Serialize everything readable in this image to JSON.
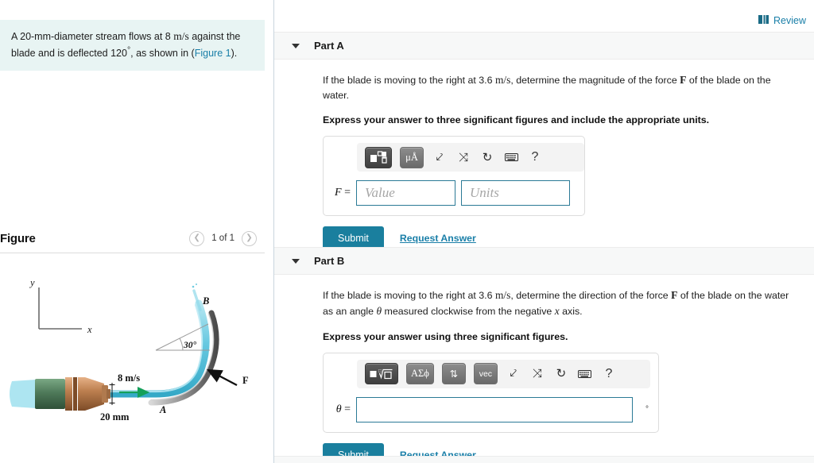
{
  "problem": {
    "text_part1": "A 20-mm-diameter stream flows at 8 ",
    "units_speed": "m/s",
    "text_part2": " against the blade and is deflected 120",
    "degree": "°",
    "text_part3": ", as shown in (",
    "figure_link": "Figure 1",
    "text_part4": ")."
  },
  "figure_panel": {
    "title": "Figure",
    "prev_icon": "chevron-left-icon",
    "next_icon": "chevron-right-icon",
    "counter": "1 of 1",
    "diagram": {
      "axis_y_label": "y",
      "axis_x_label": "x",
      "point_a": "A",
      "point_b": "B",
      "angle_label": "30°",
      "velocity_label": "8 m/s",
      "diameter_label": "20 mm",
      "force_label": "F",
      "stream_color": "#6ecbe0",
      "blade_color": "#8c8c8c",
      "nozzle_green": "#4f7a5a",
      "nozzle_copper": "#b07a4e",
      "arrow_color": "#14a05a"
    }
  },
  "review": {
    "label": "Review",
    "icon": "book-icon",
    "color": "#1a7fa8"
  },
  "parts": [
    {
      "id": "part-a",
      "title": "Part A",
      "caret_icon": "caret-down-icon",
      "question": {
        "seg1": "If the blade is moving to the right at 3.6 ",
        "units": "m/s",
        "seg2": ", determine the magnitude of the force ",
        "force_symbol": "F",
        "seg3": " of the blade on the water."
      },
      "instruction": "Express your answer to three significant figures and include the appropriate units.",
      "toolbar": [
        {
          "name": "template-palette-button",
          "glyph": "■□",
          "style": "dark"
        },
        {
          "name": "units-palette-button",
          "glyph": "μÅ",
          "style": "grey"
        },
        {
          "name": "undo-icon",
          "glyph": "↩",
          "style": "plain"
        },
        {
          "name": "redo-icon",
          "glyph": "↪",
          "style": "plain"
        },
        {
          "name": "reset-icon",
          "glyph": "↺",
          "style": "plain"
        },
        {
          "name": "keyboard-icon",
          "glyph": "⌨",
          "style": "plain"
        },
        {
          "name": "help-icon",
          "glyph": "?",
          "style": "plain"
        }
      ],
      "variable_label": "F",
      "equals": " =",
      "value_placeholder": "Value",
      "units_placeholder": "Units",
      "value_current": "",
      "units_current": "",
      "submit_label": "Submit",
      "request_label": "Request Answer"
    },
    {
      "id": "part-b",
      "title": "Part B",
      "caret_icon": "caret-down-icon",
      "question": {
        "seg1": "If the blade is moving to the right at 3.6 ",
        "units": "m/s",
        "seg2": ", determine the direction of the force ",
        "force_symbol": "F",
        "seg3": " of the blade on the water as an angle ",
        "theta_symbol": "θ",
        "seg4": " measured clockwise from the negative ",
        "x_symbol": "x",
        "seg5": " axis."
      },
      "instruction": "Express your answer using three significant figures.",
      "toolbar": [
        {
          "name": "template-palette-button",
          "glyph": "■√□",
          "style": "dark"
        },
        {
          "name": "greek-symbols-button",
          "glyph": "ΑΣϕ",
          "style": "grey"
        },
        {
          "name": "arrows-button",
          "glyph": "⇅",
          "style": "grey"
        },
        {
          "name": "vector-button",
          "glyph": "vec",
          "style": "grey"
        },
        {
          "name": "undo-icon",
          "glyph": "↩",
          "style": "plain"
        },
        {
          "name": "redo-icon",
          "glyph": "↪",
          "style": "plain"
        },
        {
          "name": "reset-icon",
          "glyph": "↺",
          "style": "plain"
        },
        {
          "name": "keyboard-icon",
          "glyph": "⌨",
          "style": "plain"
        },
        {
          "name": "help-icon",
          "glyph": "?",
          "style": "plain"
        }
      ],
      "variable_label": "θ",
      "equals": " =",
      "value_current": "",
      "value_placeholder": "",
      "degree_suffix": "°",
      "submit_label": "Submit",
      "request_label": "Request Answer"
    }
  ],
  "colors": {
    "accent_teal": "#1a7f9e",
    "link_blue": "#1a7fa8",
    "statement_bg": "#e8f4f3",
    "part_header_bg": "#f7f8f8",
    "input_border": "#2b7a96"
  }
}
